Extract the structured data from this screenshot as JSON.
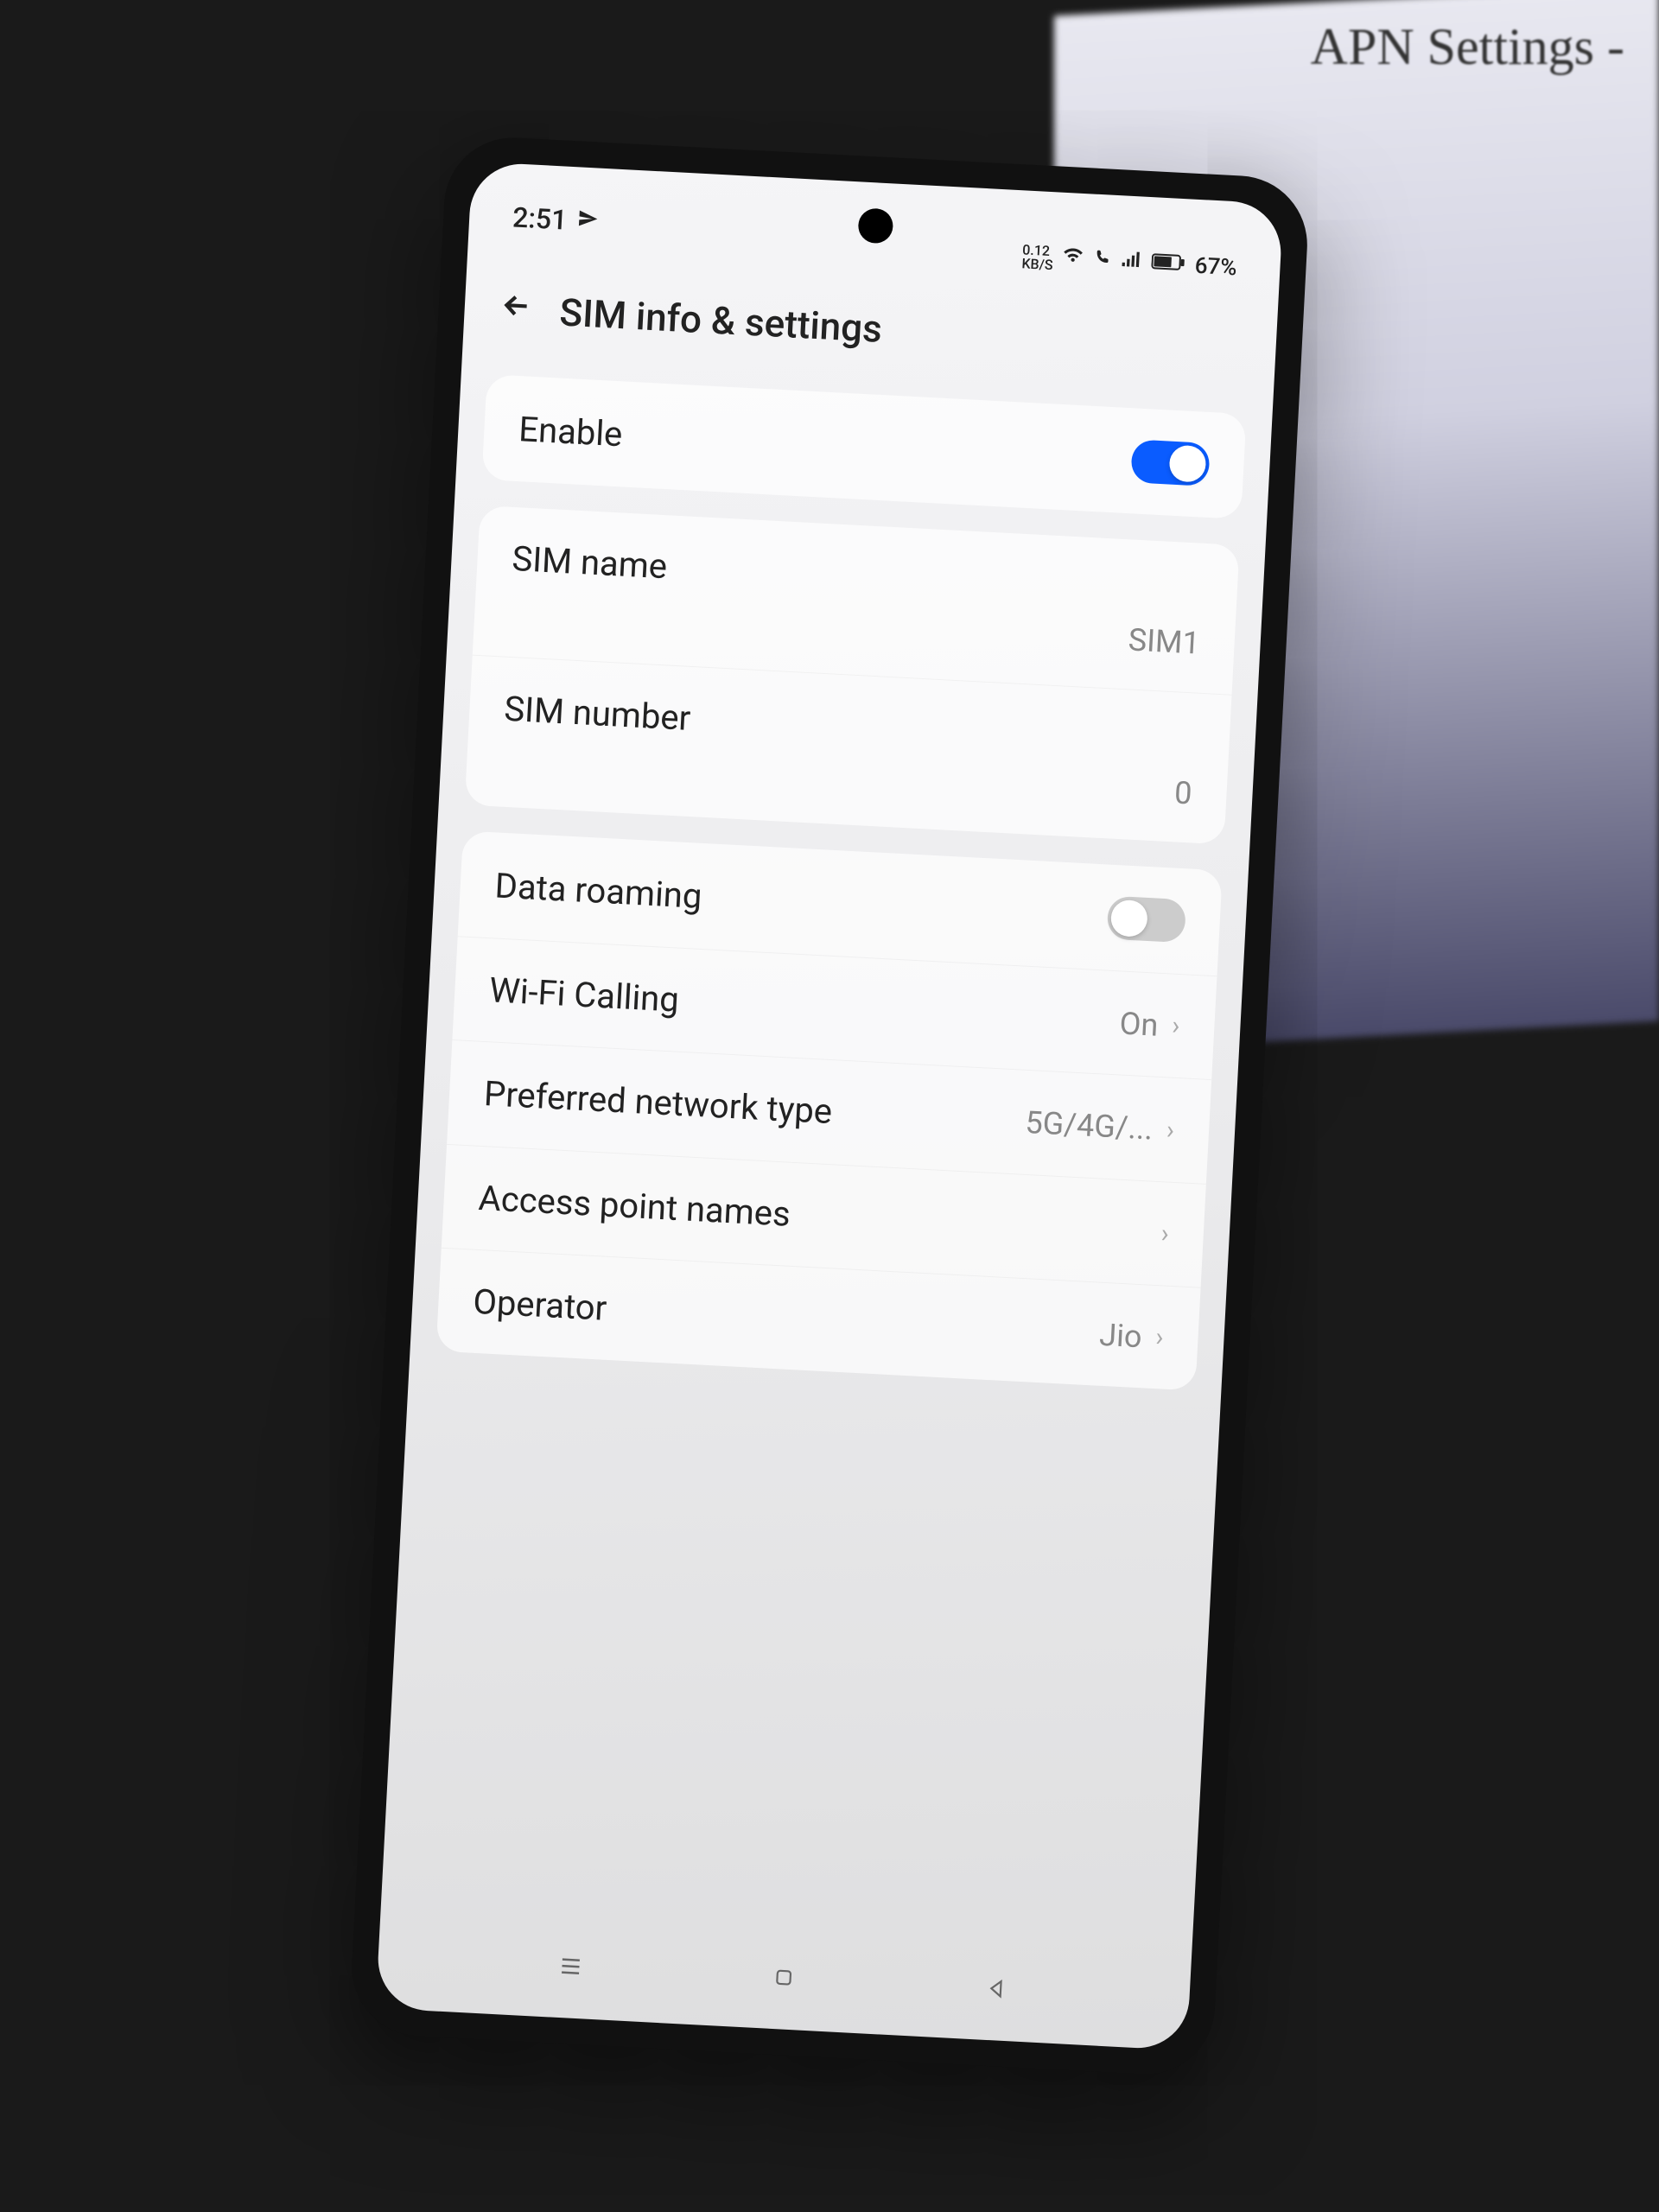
{
  "bg_monitor_text": "APN Settings -",
  "status_bar": {
    "time": "2:51",
    "net_speed_top": "0.12",
    "net_speed_bottom": "KB/S",
    "battery_pct": "67%"
  },
  "header": {
    "title": "SIM info & settings"
  },
  "card1": {
    "enable_label": "Enable",
    "enable_on": true
  },
  "card2": {
    "sim_name_label": "SIM name",
    "sim_name_value": "SIM1",
    "sim_number_label": "SIM number",
    "sim_number_value": "0"
  },
  "card3": {
    "roaming_label": "Data roaming",
    "roaming_on": false,
    "wifi_calling_label": "Wi-Fi Calling",
    "wifi_calling_value": "On",
    "network_type_label": "Preferred network type",
    "network_type_value": "5G/4G/...",
    "apn_label": "Access point names",
    "operator_label": "Operator",
    "operator_value": "Jio"
  }
}
